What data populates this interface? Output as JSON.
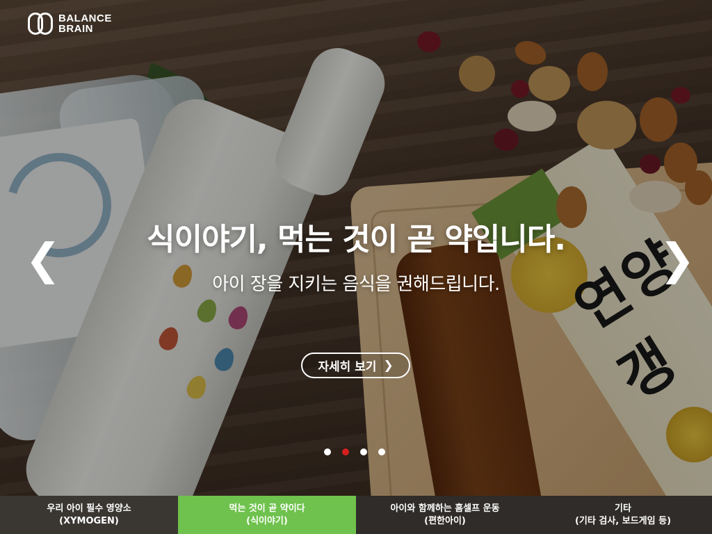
{
  "brand": {
    "line1": "BALANCE",
    "line2": "BRAIN"
  },
  "slide": {
    "headline": "식이야기, 먹는 것이 곧 약입니다.",
    "subline": "아이 장을 지키는 음식을 권해드립니다.",
    "cta_label": "자세히 보기",
    "cta_icon": "chevron-right-icon",
    "prev_icon": "chevron-left-icon",
    "next_icon": "chevron-right-icon",
    "active_index": 1,
    "count": 4
  },
  "product_text": {
    "jelly_package": "연양갱"
  },
  "tabs": [
    {
      "line1": "우리 아이 필수 영양소",
      "line2": "(XYMOGEN)",
      "active": false
    },
    {
      "line1": "먹는 것이 곧 약이다",
      "line2": "(식이야기)",
      "active": true
    },
    {
      "line1": "아이와 함께하는 홈셀프 운동",
      "line2": "(편한아이)",
      "active": false
    },
    {
      "line1": "기타",
      "line2": "(기타 검사, 보드게임 등)",
      "active": false
    }
  ],
  "colors": {
    "accent_green": "#6fc24d",
    "active_dot": "#d51f1f"
  }
}
